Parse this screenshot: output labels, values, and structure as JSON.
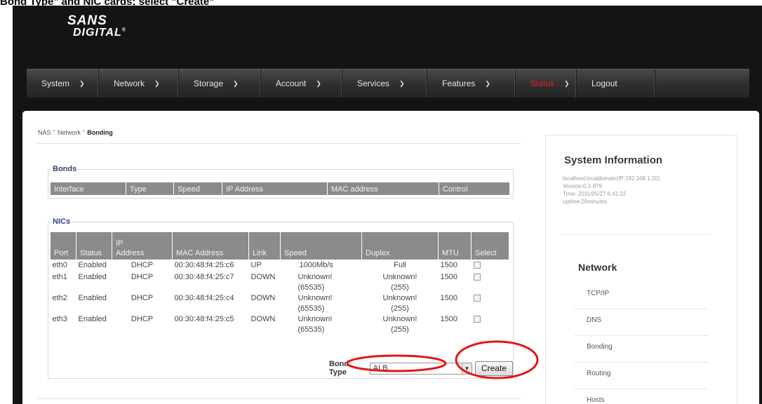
{
  "caption": "Bond Type\" and NIC cards; select \"Create\"",
  "logo": {
    "line1": "SANS",
    "line2": "DIGITAL",
    "reg": "®"
  },
  "nav": [
    {
      "label": "System",
      "active": false
    },
    {
      "label": "Network",
      "active": false
    },
    {
      "label": "Storage",
      "active": false
    },
    {
      "label": "Account",
      "active": false
    },
    {
      "label": "Services",
      "active": false
    },
    {
      "label": "Features",
      "active": false
    },
    {
      "label": "Status",
      "active": true
    },
    {
      "label": "Logout",
      "active": false
    }
  ],
  "breadcrumb": {
    "root": "NAS",
    "section": "Network",
    "current": "Bonding",
    "sep": "»"
  },
  "bonds": {
    "legend": "Bonds",
    "columns": [
      "Interface",
      "Type",
      "Speed",
      "IP Address",
      "MAC address",
      "Control"
    ]
  },
  "nics": {
    "legend": "NICs",
    "columns": {
      "port": "Port",
      "status": "Status",
      "ip1": "IP",
      "ip2": "Address",
      "mac": "MAC Address",
      "link": "Link",
      "speed": "Speed",
      "duplex": "Duplex",
      "mtu": "MTU",
      "select": "Select"
    },
    "rows": [
      {
        "port": "eth0",
        "status": "Enabled",
        "ip": "DHCP",
        "mac": "00:30:48:f4:25:c6",
        "link": "UP",
        "speed": "1000Mb/s",
        "speed2": "",
        "duplex": "Full",
        "duplex2": "",
        "mtu": "1500"
      },
      {
        "port": "eth1",
        "status": "Enabled",
        "ip": "DHCP",
        "mac": "00:30:48:f4:25:c7",
        "link": "DOWN",
        "speed": "Unknown!",
        "speed2": "(65535)",
        "duplex": "Unknown!",
        "duplex2": "(255)",
        "mtu": "1500"
      },
      {
        "port": "eth2",
        "status": "Enabled",
        "ip": "DHCP",
        "mac": "00:30:48:f4:25:c4",
        "link": "DOWN",
        "speed": "Unknown!",
        "speed2": "(65535)",
        "duplex": "Unknown!",
        "duplex2": "(255)",
        "mtu": "1500"
      },
      {
        "port": "eth3",
        "status": "Enabled",
        "ip": "DHCP",
        "mac": "00:30:48:f4:25:c5",
        "link": "DOWN",
        "speed": "Unknown!",
        "speed2": "(65535)",
        "duplex": "Unknown!",
        "duplex2": "(255)",
        "mtu": "1500"
      }
    ],
    "bond_type_label": "Bond Type",
    "bond_type_value": "ALB",
    "create_label": "Create"
  },
  "sysinfo": {
    "title": "System Information",
    "host": "localhost.localdomain(IP:192.168.1.20)",
    "version": "Version:0.2-879",
    "time": "Time: 2011/05/27 6:41:22",
    "uptime": "uptime:20minutes",
    "section": "Network",
    "links": [
      "TCP/IP",
      "DNS",
      "Bonding",
      "Routing",
      "Hosts"
    ]
  },
  "colors": {
    "accent_active": "#e0252d",
    "annotation": "#e01818",
    "legend": "#33427a",
    "header_bg": "#8b8b8b"
  }
}
